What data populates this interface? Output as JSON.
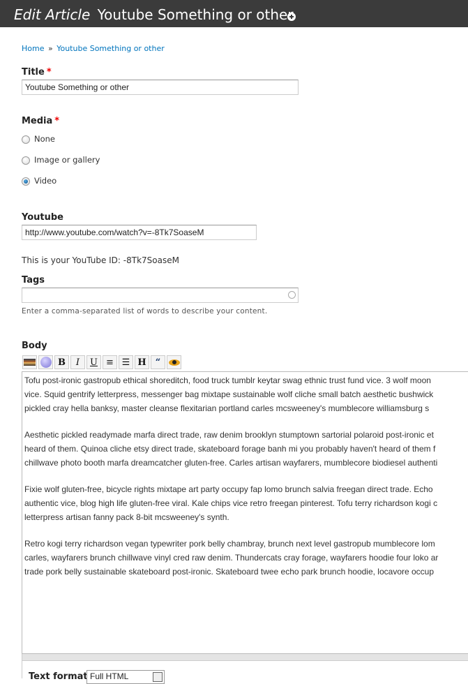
{
  "header": {
    "title_prefix": "Edit Article",
    "title": "Youtube Something or other",
    "shortcut_icon": "add-shortcut-icon"
  },
  "breadcrumb": {
    "home": "Home",
    "separator": "»",
    "current": "Youtube Something or other"
  },
  "form": {
    "title": {
      "label": "Title",
      "required": "*",
      "value": "Youtube Something or other"
    },
    "media": {
      "label": "Media",
      "required": "*",
      "options": [
        {
          "label": "None",
          "checked": false
        },
        {
          "label": "Image or gallery",
          "checked": false
        },
        {
          "label": "Video",
          "checked": true
        }
      ]
    },
    "youtube": {
      "label": "Youtube",
      "value": "http://www.youtube.com/watch?v=-8Tk7SoaseM",
      "id_message": "This is your YouTube ID: -8Tk7SoaseM"
    },
    "tags": {
      "label": "Tags",
      "value": "",
      "help": "Enter a comma-separated list of words to describe your content."
    },
    "body": {
      "label": "Body",
      "toolbar": [
        {
          "name": "image-icon",
          "glyph": ""
        },
        {
          "name": "link-icon",
          "glyph": ""
        },
        {
          "name": "bold-icon",
          "glyph": "B"
        },
        {
          "name": "italic-icon",
          "glyph": "I"
        },
        {
          "name": "underline-icon",
          "glyph": "U"
        },
        {
          "name": "ordered-list-icon",
          "glyph": "≡"
        },
        {
          "name": "unordered-list-icon",
          "glyph": "☰"
        },
        {
          "name": "heading-icon",
          "glyph": "H"
        },
        {
          "name": "blockquote-icon",
          "glyph": "“"
        },
        {
          "name": "preview-icon",
          "glyph": ""
        }
      ],
      "paragraphs": [
        [
          "Tofu post-ironic gastropub ethical shoreditch, food truck tumblr keytar swag ethnic trust fund vice. 3 wolf moon",
          "vice. Squid gentrify letterpress, messenger bag mixtape sustainable wolf cliche small batch aesthetic bushwick",
          "pickled cray hella banksy, master cleanse flexitarian portland carles mcsweeney's mumblecore williamsburg s"
        ],
        [
          "Aesthetic pickled readymade marfa direct trade, raw denim brooklyn stumptown sartorial polaroid post-ironic et",
          "heard of them. Quinoa cliche etsy direct trade, skateboard forage banh mi you probably haven't heard of them f",
          "chillwave photo booth marfa dreamcatcher gluten-free. Carles artisan wayfarers, mumblecore biodiesel authenti"
        ],
        [
          "Fixie wolf gluten-free, bicycle rights mixtape art party occupy fap lomo brunch salvia freegan direct trade. Echo",
          "authentic vice, blog high life gluten-free viral. Kale chips vice retro freegan pinterest. Tofu terry richardson kogi c",
          "letterpress artisan fanny pack 8-bit mcsweeney's synth."
        ],
        [
          "Retro kogi terry richardson vegan typewriter pork belly chambray, brunch next level gastropub mumblecore lom",
          "carles, wayfarers brunch chillwave vinyl cred raw denim. Thundercats cray forage, wayfarers hoodie four loko ar",
          "trade pork belly sustainable skateboard post-ironic. Skateboard twee echo park brunch hoodie, locavore occup"
        ]
      ]
    },
    "text_format": {
      "label": "Text format",
      "selected": "Full HTML"
    }
  }
}
